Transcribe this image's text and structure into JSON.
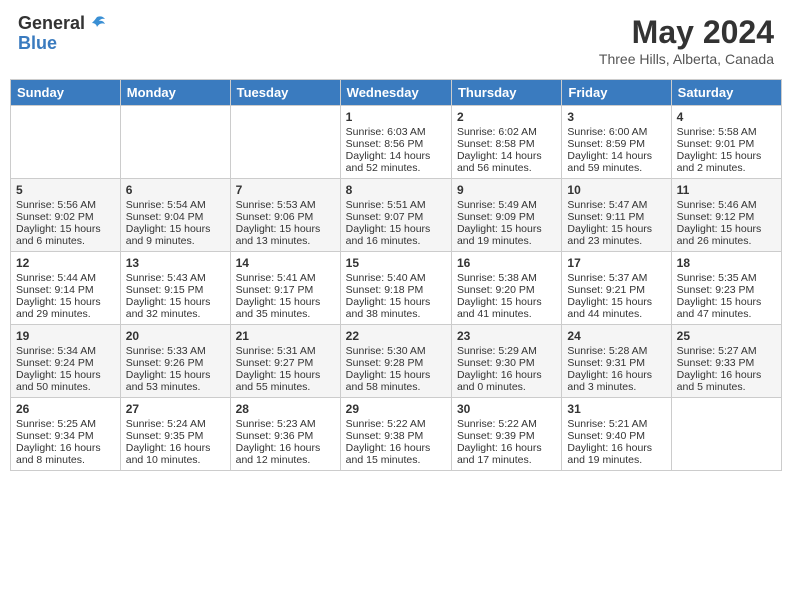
{
  "header": {
    "logo_line1": "General",
    "logo_line2": "Blue",
    "month_title": "May 2024",
    "location": "Three Hills, Alberta, Canada"
  },
  "weekdays": [
    "Sunday",
    "Monday",
    "Tuesday",
    "Wednesday",
    "Thursday",
    "Friday",
    "Saturday"
  ],
  "weeks": [
    [
      {
        "day": "",
        "info": ""
      },
      {
        "day": "",
        "info": ""
      },
      {
        "day": "",
        "info": ""
      },
      {
        "day": "1",
        "info": "Sunrise: 6:03 AM\nSunset: 8:56 PM\nDaylight: 14 hours and 52 minutes."
      },
      {
        "day": "2",
        "info": "Sunrise: 6:02 AM\nSunset: 8:58 PM\nDaylight: 14 hours and 56 minutes."
      },
      {
        "day": "3",
        "info": "Sunrise: 6:00 AM\nSunset: 8:59 PM\nDaylight: 14 hours and 59 minutes."
      },
      {
        "day": "4",
        "info": "Sunrise: 5:58 AM\nSunset: 9:01 PM\nDaylight: 15 hours and 2 minutes."
      }
    ],
    [
      {
        "day": "5",
        "info": "Sunrise: 5:56 AM\nSunset: 9:02 PM\nDaylight: 15 hours and 6 minutes."
      },
      {
        "day": "6",
        "info": "Sunrise: 5:54 AM\nSunset: 9:04 PM\nDaylight: 15 hours and 9 minutes."
      },
      {
        "day": "7",
        "info": "Sunrise: 5:53 AM\nSunset: 9:06 PM\nDaylight: 15 hours and 13 minutes."
      },
      {
        "day": "8",
        "info": "Sunrise: 5:51 AM\nSunset: 9:07 PM\nDaylight: 15 hours and 16 minutes."
      },
      {
        "day": "9",
        "info": "Sunrise: 5:49 AM\nSunset: 9:09 PM\nDaylight: 15 hours and 19 minutes."
      },
      {
        "day": "10",
        "info": "Sunrise: 5:47 AM\nSunset: 9:11 PM\nDaylight: 15 hours and 23 minutes."
      },
      {
        "day": "11",
        "info": "Sunrise: 5:46 AM\nSunset: 9:12 PM\nDaylight: 15 hours and 26 minutes."
      }
    ],
    [
      {
        "day": "12",
        "info": "Sunrise: 5:44 AM\nSunset: 9:14 PM\nDaylight: 15 hours and 29 minutes."
      },
      {
        "day": "13",
        "info": "Sunrise: 5:43 AM\nSunset: 9:15 PM\nDaylight: 15 hours and 32 minutes."
      },
      {
        "day": "14",
        "info": "Sunrise: 5:41 AM\nSunset: 9:17 PM\nDaylight: 15 hours and 35 minutes."
      },
      {
        "day": "15",
        "info": "Sunrise: 5:40 AM\nSunset: 9:18 PM\nDaylight: 15 hours and 38 minutes."
      },
      {
        "day": "16",
        "info": "Sunrise: 5:38 AM\nSunset: 9:20 PM\nDaylight: 15 hours and 41 minutes."
      },
      {
        "day": "17",
        "info": "Sunrise: 5:37 AM\nSunset: 9:21 PM\nDaylight: 15 hours and 44 minutes."
      },
      {
        "day": "18",
        "info": "Sunrise: 5:35 AM\nSunset: 9:23 PM\nDaylight: 15 hours and 47 minutes."
      }
    ],
    [
      {
        "day": "19",
        "info": "Sunrise: 5:34 AM\nSunset: 9:24 PM\nDaylight: 15 hours and 50 minutes."
      },
      {
        "day": "20",
        "info": "Sunrise: 5:33 AM\nSunset: 9:26 PM\nDaylight: 15 hours and 53 minutes."
      },
      {
        "day": "21",
        "info": "Sunrise: 5:31 AM\nSunset: 9:27 PM\nDaylight: 15 hours and 55 minutes."
      },
      {
        "day": "22",
        "info": "Sunrise: 5:30 AM\nSunset: 9:28 PM\nDaylight: 15 hours and 58 minutes."
      },
      {
        "day": "23",
        "info": "Sunrise: 5:29 AM\nSunset: 9:30 PM\nDaylight: 16 hours and 0 minutes."
      },
      {
        "day": "24",
        "info": "Sunrise: 5:28 AM\nSunset: 9:31 PM\nDaylight: 16 hours and 3 minutes."
      },
      {
        "day": "25",
        "info": "Sunrise: 5:27 AM\nSunset: 9:33 PM\nDaylight: 16 hours and 5 minutes."
      }
    ],
    [
      {
        "day": "26",
        "info": "Sunrise: 5:25 AM\nSunset: 9:34 PM\nDaylight: 16 hours and 8 minutes."
      },
      {
        "day": "27",
        "info": "Sunrise: 5:24 AM\nSunset: 9:35 PM\nDaylight: 16 hours and 10 minutes."
      },
      {
        "day": "28",
        "info": "Sunrise: 5:23 AM\nSunset: 9:36 PM\nDaylight: 16 hours and 12 minutes."
      },
      {
        "day": "29",
        "info": "Sunrise: 5:22 AM\nSunset: 9:38 PM\nDaylight: 16 hours and 15 minutes."
      },
      {
        "day": "30",
        "info": "Sunrise: 5:22 AM\nSunset: 9:39 PM\nDaylight: 16 hours and 17 minutes."
      },
      {
        "day": "31",
        "info": "Sunrise: 5:21 AM\nSunset: 9:40 PM\nDaylight: 16 hours and 19 minutes."
      },
      {
        "day": "",
        "info": ""
      }
    ]
  ]
}
